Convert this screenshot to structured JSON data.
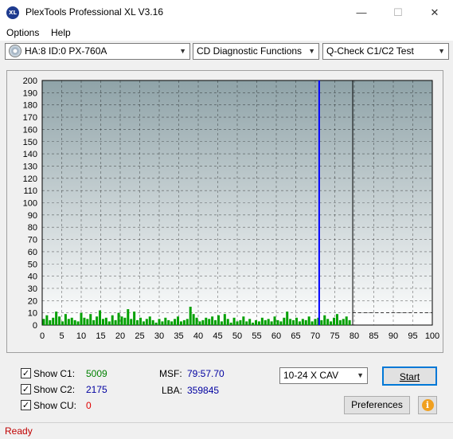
{
  "window": {
    "title": "PlexTools Professional XL V3.16",
    "icon_label": "XL",
    "minimize": "—",
    "maximize": "☐",
    "close": "✕"
  },
  "menu": [
    "Options",
    "Help"
  ],
  "toolbar": {
    "drive": "HA:8 ID:0  PX-760A",
    "function": "CD Diagnostic Functions",
    "test": "Q-Check C1/C2 Test"
  },
  "chart_data": {
    "type": "bar",
    "xlim": [
      0,
      100
    ],
    "ylim": [
      0,
      200
    ],
    "x_ticks": [
      0,
      5,
      10,
      15,
      20,
      25,
      30,
      35,
      40,
      45,
      50,
      55,
      60,
      65,
      70,
      75,
      80,
      85,
      90,
      95,
      100
    ],
    "y_ticks": [
      0,
      10,
      20,
      30,
      40,
      50,
      60,
      70,
      80,
      90,
      100,
      110,
      120,
      130,
      140,
      150,
      160,
      170,
      180,
      190,
      200
    ],
    "grid": true,
    "series": [
      {
        "color": "#00a000",
        "x": [
          0.4,
          1.2,
          2.0,
          2.8,
          3.6,
          4.4,
          5.2,
          6.0,
          6.8,
          7.6,
          8.4,
          9.2,
          10.0,
          10.8,
          11.6,
          12.4,
          13.2,
          14.0,
          14.8,
          15.6,
          16.4,
          17.2,
          18.0,
          18.8,
          19.6,
          20.4,
          21.2,
          22.0,
          22.8,
          23.6,
          24.4,
          25.2,
          26.0,
          26.8,
          27.6,
          28.4,
          29.2,
          30.0,
          30.8,
          31.6,
          32.4,
          33.2,
          34.0,
          34.8,
          35.6,
          36.4,
          37.2,
          38.0,
          38.8,
          39.6,
          40.4,
          41.2,
          42.0,
          42.8,
          43.6,
          44.4,
          45.2,
          46.0,
          46.8,
          47.6,
          48.4,
          49.2,
          50.0,
          50.8,
          51.6,
          52.4,
          53.2,
          54.0,
          54.8,
          55.6,
          56.4,
          57.2,
          58.0,
          58.8,
          59.6,
          60.4,
          61.2,
          62.0,
          62.8,
          63.6,
          64.4,
          65.2,
          66.0,
          66.8,
          67.6,
          68.4,
          69.2,
          70.0,
          70.8,
          71.6,
          72.4,
          73.2,
          74.0,
          74.8,
          75.6,
          76.4,
          77.2,
          78.0,
          78.8
        ],
        "values": [
          5,
          8,
          4,
          6,
          11,
          7,
          3,
          9,
          5,
          6,
          4,
          3,
          10,
          6,
          5,
          9,
          4,
          7,
          12,
          5,
          6,
          3,
          8,
          4,
          10,
          7,
          6,
          13,
          5,
          11,
          4,
          6,
          3,
          5,
          7,
          4,
          2,
          5,
          3,
          6,
          4,
          3,
          5,
          7,
          3,
          4,
          5,
          15,
          9,
          6,
          3,
          4,
          6,
          5,
          7,
          4,
          8,
          3,
          9,
          5,
          2,
          6,
          3,
          4,
          7,
          3,
          5,
          2,
          4,
          3,
          6,
          4,
          5,
          3,
          7,
          4,
          3,
          6,
          11,
          5,
          4,
          6,
          3,
          5,
          4,
          7,
          3,
          5,
          6,
          4,
          8,
          5,
          3,
          6,
          9,
          4,
          5,
          7,
          4
        ]
      }
    ],
    "markers": [
      {
        "x": 71,
        "color": "#0000ff"
      },
      {
        "x": 79.6,
        "color": "#000000"
      }
    ],
    "threshold": {
      "y": 10
    }
  },
  "controls": {
    "show_c1_label": "Show C1:",
    "show_c2_label": "Show C2:",
    "show_cu_label": "Show CU:",
    "c1_value": "5009",
    "c2_value": "2175",
    "cu_value": "0",
    "msf_label": "MSF:",
    "msf_value": "79:57.70",
    "lba_label": "LBA:",
    "lba_value": "359845",
    "speed": "10-24 X CAV",
    "start": "Start",
    "preferences": "Preferences",
    "info_icon_glyph": "i",
    "check_glyph": "✓"
  },
  "status": "Ready"
}
